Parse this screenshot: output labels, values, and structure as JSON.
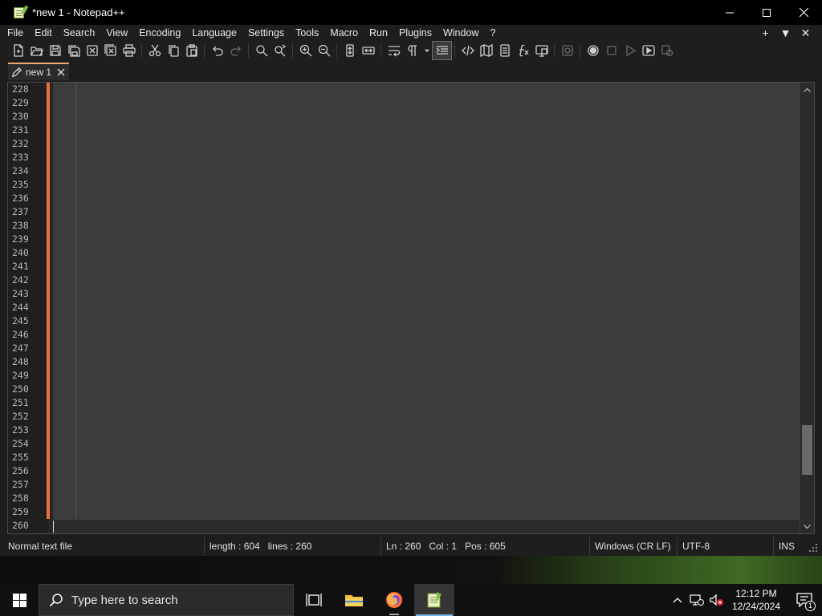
{
  "window": {
    "title": "*new 1 - Notepad++"
  },
  "menu": {
    "items": [
      "File",
      "Edit",
      "Search",
      "View",
      "Encoding",
      "Language",
      "Settings",
      "Tools",
      "Macro",
      "Run",
      "Plugins",
      "Window",
      "?"
    ],
    "right_controls": [
      "+",
      "▼",
      "✕"
    ]
  },
  "toolbar": {
    "icons": [
      "new-file-icon",
      "open-file-icon",
      "save-icon",
      "save-all-icon",
      "close-icon",
      "close-all-icon",
      "print-icon",
      "cut-icon",
      "copy-icon",
      "paste-icon",
      "undo-icon",
      "redo-icon",
      "find-icon",
      "replace-icon",
      "zoom-in-icon",
      "zoom-out-icon",
      "sync-vertical-icon",
      "sync-horizontal-icon",
      "word-wrap-icon",
      "show-all-characters-icon",
      "indent-guide-icon",
      "xml-tag-icon",
      "document-map-icon",
      "document-list-icon",
      "function-list-icon",
      "folder-as-workspace-icon",
      "monitoring-icon",
      "record-macro-icon",
      "stop-recording-icon",
      "playback-macro-icon",
      "run-macro-multiple-icon",
      "save-macro-icon"
    ]
  },
  "tabs": [
    {
      "label": "new 1",
      "modified": true
    }
  ],
  "editor": {
    "line_numbers": [
      "228",
      "229",
      "230",
      "231",
      "232",
      "233",
      "234",
      "235",
      "236",
      "237",
      "238",
      "239",
      "240",
      "241",
      "242",
      "243",
      "244",
      "245",
      "246",
      "247",
      "248",
      "249",
      "250",
      "251",
      "252",
      "253",
      "254",
      "255",
      "256",
      "257",
      "258",
      "259",
      "260"
    ],
    "current_line": "260"
  },
  "status": {
    "file_type": "Normal text file",
    "length": "length : 604",
    "lines": "lines : 260",
    "ln": "Ln : 260",
    "col": "Col : 1",
    "pos": "Pos : 605",
    "eol": "Windows (CR LF)",
    "encoding": "UTF-8",
    "mode": "INS"
  },
  "taskbar": {
    "search_placeholder": "Type here to search",
    "time": "12:12 PM",
    "date": "12/24/2024",
    "notification_count": "1"
  },
  "colors": {
    "change_bar": "#ef6e3b",
    "tab_accent": "#f2a96b",
    "taskbar_active": "#76b9ed"
  }
}
